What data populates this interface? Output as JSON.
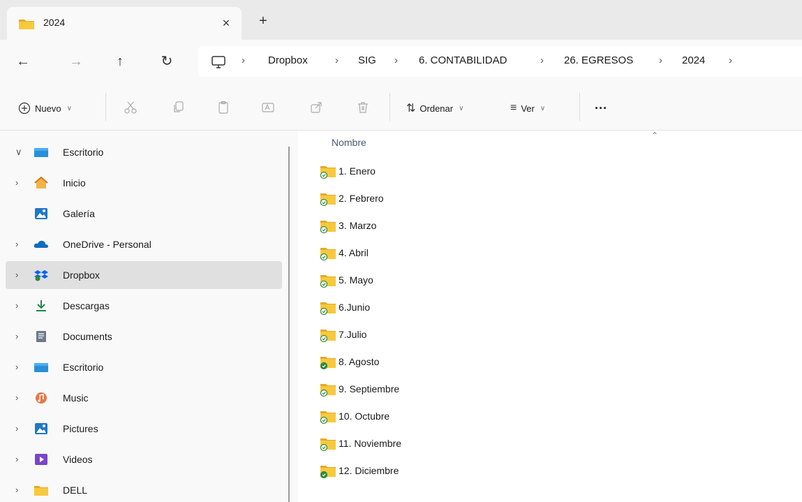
{
  "tab": {
    "title": "2024",
    "close_glyph": "×",
    "new_tab_glyph": "+"
  },
  "nav_buttons": {
    "back": "←",
    "forward": "→",
    "up": "↑",
    "refresh": "↻"
  },
  "breadcrumb": {
    "items": [
      "Dropbox",
      "SIG",
      "6. CONTABILIDAD",
      "26. EGRESOS",
      "2024"
    ],
    "separator": "›"
  },
  "toolbar": {
    "new_label": "Nuevo",
    "sort_label": "Ordenar",
    "view_label": "Ver",
    "more_glyph": "···"
  },
  "sidebar": {
    "items": [
      {
        "label": "Escritorio",
        "icon": "desktop-icon",
        "chevron": "expanded"
      },
      {
        "label": "Inicio",
        "icon": "home-icon",
        "chevron": "collapsed"
      },
      {
        "label": "Galería",
        "icon": "gallery-icon",
        "chevron": "none"
      },
      {
        "label": "OneDrive - Personal",
        "icon": "onedrive-icon",
        "chevron": "collapsed"
      },
      {
        "label": "Dropbox",
        "icon": "dropbox-icon",
        "chevron": "collapsed",
        "selected": true
      },
      {
        "label": "Descargas",
        "icon": "download-icon",
        "chevron": "collapsed"
      },
      {
        "label": "Documents",
        "icon": "documents-icon",
        "chevron": "collapsed"
      },
      {
        "label": "Escritorio",
        "icon": "desktop-icon",
        "chevron": "collapsed"
      },
      {
        "label": "Music",
        "icon": "music-icon",
        "chevron": "collapsed"
      },
      {
        "label": "Pictures",
        "icon": "pictures-icon",
        "chevron": "collapsed"
      },
      {
        "label": "Videos",
        "icon": "videos-icon",
        "chevron": "collapsed"
      },
      {
        "label": "DELL",
        "icon": "folder-icon",
        "chevron": "collapsed"
      }
    ]
  },
  "content": {
    "column_header": "Nombre",
    "files": [
      {
        "name": "1. Enero",
        "sync": "outline"
      },
      {
        "name": "2. Febrero",
        "sync": "outline"
      },
      {
        "name": "3. Marzo",
        "sync": "outline"
      },
      {
        "name": "4. Abril",
        "sync": "outline"
      },
      {
        "name": "5. Mayo",
        "sync": "outline"
      },
      {
        "name": "6.Junio",
        "sync": "outline"
      },
      {
        "name": "7.Julio",
        "sync": "outline"
      },
      {
        "name": "8. Agosto",
        "sync": "solid"
      },
      {
        "name": "9. Septiembre",
        "sync": "outline"
      },
      {
        "name": "10. Octubre",
        "sync": "outline"
      },
      {
        "name": "11. Noviembre",
        "sync": "outline"
      },
      {
        "name": "12. Diciembre",
        "sync": "solid"
      }
    ]
  },
  "colors": {
    "folder": "#f8c93c",
    "folder_tab": "#e8a820",
    "sync_green": "#2f8a3c",
    "selected_bg": "#e0e0e0"
  }
}
